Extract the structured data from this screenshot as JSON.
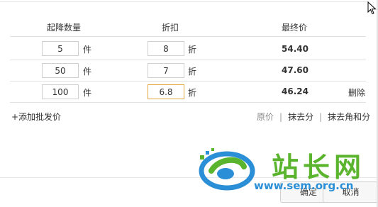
{
  "headers": {
    "quantity": "起降数量",
    "discount": "折扣",
    "final_price": "最终价"
  },
  "unit_piece": "件",
  "unit_discount": "折",
  "rows": [
    {
      "quantity": "5",
      "discount": "8",
      "price": "54.40",
      "delete": ""
    },
    {
      "quantity": "50",
      "discount": "7",
      "price": "47.60",
      "delete": ""
    },
    {
      "quantity": "100",
      "discount": "6.8",
      "price": "46.24",
      "delete": "删除"
    }
  ],
  "add_link": "+添加批发价",
  "rounding": {
    "original": "原价",
    "sep": "|",
    "round_fen": "抹去分",
    "round_jiao_fen": "抹去角和分"
  },
  "buttons": {
    "ok": "确定",
    "cancel": "取消"
  },
  "watermark": {
    "text": "站长网",
    "url": "www.sem.org.cn"
  },
  "colors": {
    "focus_border": "#e3a93f",
    "watermark_green": "#5ab42d",
    "watermark_blue": "#2a8fd6"
  }
}
